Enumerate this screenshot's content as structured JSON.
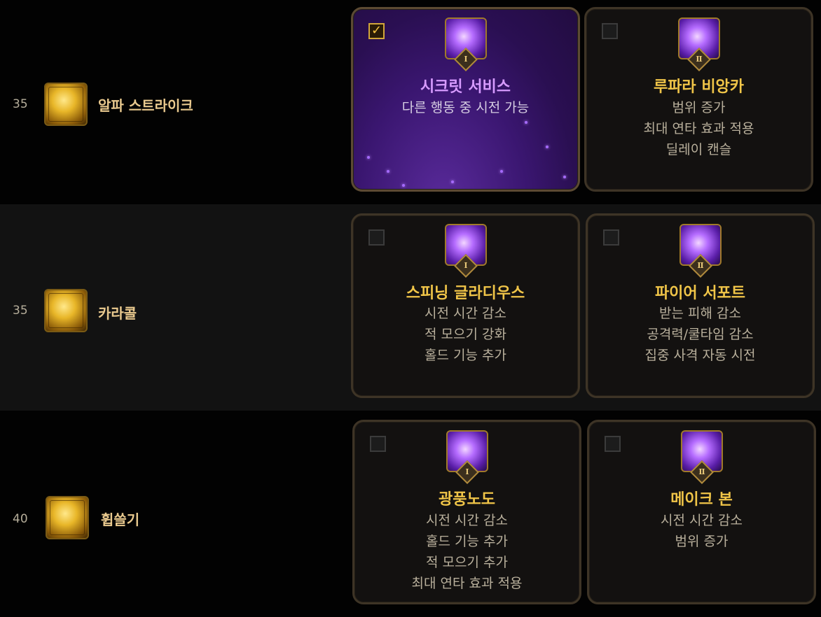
{
  "rows": [
    {
      "level": "35",
      "skill_name": "알파 스트라이크",
      "tripods": [
        {
          "name": "시크릿 서비스",
          "selected": true,
          "tier": "Ⅰ",
          "desc": [
            "다른 행동 중 시전 가능"
          ]
        },
        {
          "name": "루파라 비앙카",
          "selected": false,
          "tier": "Ⅱ",
          "desc": [
            "범위 증가",
            "최대 연타 효과 적용",
            "딜레이 캔슬"
          ]
        }
      ]
    },
    {
      "level": "35",
      "skill_name": "카라콜",
      "tripods": [
        {
          "name": "스피닝 글라디우스",
          "selected": false,
          "tier": "Ⅰ",
          "desc": [
            "시전 시간 감소",
            "적 모으기 강화",
            "홀드 기능 추가"
          ]
        },
        {
          "name": "파이어 서포트",
          "selected": false,
          "tier": "Ⅱ",
          "desc": [
            "받는 피해 감소",
            "공격력/쿨타임 감소",
            "집중 사격 자동 시전"
          ]
        }
      ]
    },
    {
      "level": "40",
      "skill_name": "휩쓸기",
      "tripods": [
        {
          "name": "광풍노도",
          "selected": false,
          "tier": "Ⅰ",
          "desc": [
            "시전 시간 감소",
            "홀드 기능 추가",
            "적 모으기 추가",
            "최대 연타 효과 적용"
          ]
        },
        {
          "name": "메이크 본",
          "selected": false,
          "tier": "Ⅱ",
          "desc": [
            "시전 시간 감소",
            "범위 증가"
          ]
        }
      ]
    }
  ],
  "icons": {
    "skill": "skill-icon",
    "tripod": "tripod-icon",
    "checkbox_checked": "checkbox-checked-icon",
    "checkbox_empty": "checkbox-empty-icon"
  },
  "colors": {
    "tripod_name": "#f0c548",
    "selected_tripod_name": "#d79bff",
    "skill_name": "#e9c98e",
    "card_border": "#3e3426"
  }
}
